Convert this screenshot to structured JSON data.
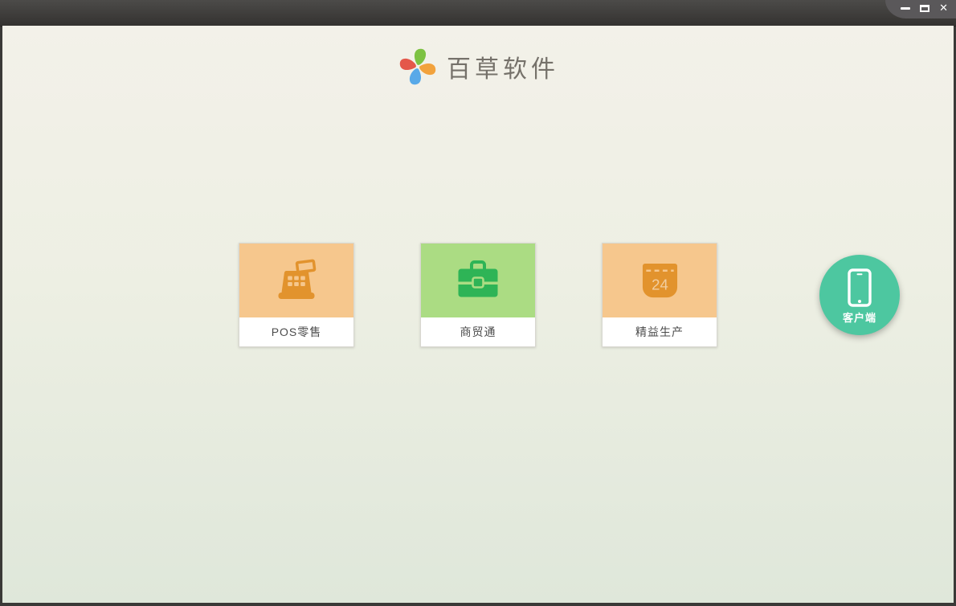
{
  "window": {
    "title_bar_controls": [
      {
        "icon": "minimize-icon"
      },
      {
        "icon": "maximize-icon"
      },
      {
        "icon": "close-icon",
        "glyph": "✕"
      }
    ]
  },
  "header": {
    "brand_name": "百草软件",
    "logo_petals": {
      "top": "#7dc242",
      "right": "#f2a23c",
      "bottom": "#58a9e8",
      "left": "#e4584a"
    }
  },
  "products": [
    {
      "label": "POS零售",
      "icon": "cash-register-icon",
      "tile_bg": "#f6c78d",
      "icon_color": "#e2932d"
    },
    {
      "label": "商贸通",
      "icon": "briefcase-icon",
      "tile_bg": "#abdc83",
      "icon_color": "#2eb456"
    },
    {
      "label": "精益生产",
      "icon": "calendar-icon",
      "tile_bg": "#f6c78d",
      "icon_color": "#e2932d",
      "calendar_day": "24"
    }
  ],
  "client_button": {
    "label": "客户端",
    "icon": "smartphone-icon",
    "bg_color": "#4dc7a0"
  }
}
